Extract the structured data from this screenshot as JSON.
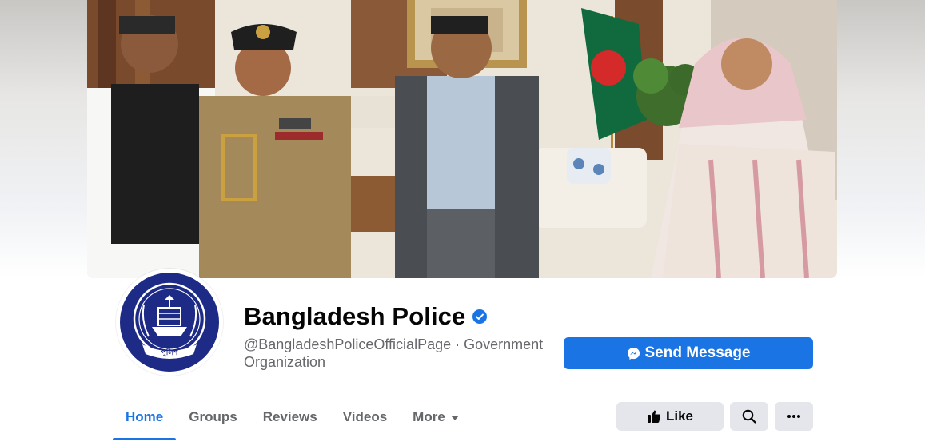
{
  "page": {
    "name": "Bangladesh Police",
    "handle_and_category": "@BangladeshPoliceOfficialPage · Government Organization",
    "verified_icon": "verified-check-icon"
  },
  "cover": {
    "icon": "cover-photo"
  },
  "avatar": {
    "emblem_text": "পুলিশ"
  },
  "actions": {
    "send_message_label": "Send Message",
    "send_message_icon": "messenger-icon",
    "like_label": "Like",
    "like_icon": "thumbs-up-icon",
    "search_icon": "search-icon",
    "more_icon": "ellipsis-icon"
  },
  "tabs": [
    {
      "label": "Home",
      "active": true
    },
    {
      "label": "Groups",
      "active": false
    },
    {
      "label": "Reviews",
      "active": false
    },
    {
      "label": "Videos",
      "active": false
    },
    {
      "label": "More",
      "active": false
    }
  ],
  "colors": {
    "accent": "#1b74e4",
    "secondary_text": "#65676b",
    "button_gray": "#e4e6eb",
    "emblem_blue": "#1d2a86"
  }
}
